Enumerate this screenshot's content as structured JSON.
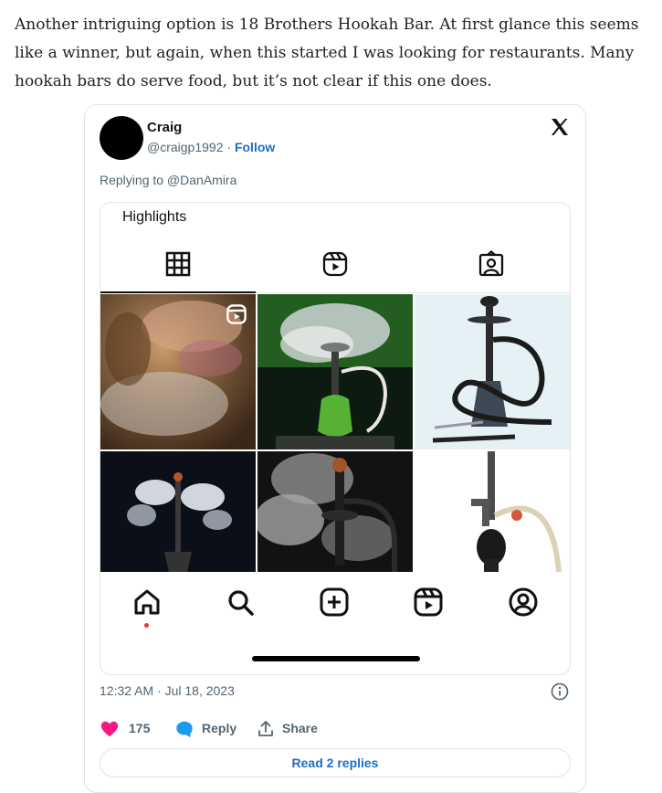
{
  "article": {
    "paragraph": "Another intriguing option is 18 Brothers Hookah Bar. At first glance this seems like a winner, but again, when this started I was looking for restaurants. Many hookah bars do serve food, but it’s not clear if this one does."
  },
  "tweet": {
    "name": "Craig",
    "handle": "@craigp1992",
    "separator": " · ",
    "follow_label": "Follow",
    "replying_to": "Replying to @DanAmira",
    "timestamp": "12:32 AM · Jul 18, 2023",
    "likes": "175",
    "reply_label": "Reply",
    "share_label": "Share",
    "read_replies_label": "Read 2 replies",
    "like_color": "#f91880",
    "accent_color": "#1d6fc2"
  },
  "embed": {
    "highlights_label": "Highlights",
    "tabs": [
      "grid-icon",
      "reels-icon",
      "tagged-icon"
    ],
    "tiles": [
      {
        "subject": "smoky party scene",
        "reel_badge": true
      },
      {
        "subject": "green glass hookah with smoke"
      },
      {
        "subject": "black hookah with long hose"
      },
      {
        "subject": "hookah with twin smoke plumes"
      },
      {
        "subject": "hookah in dense smoke"
      },
      {
        "subject": "rifle-shaped hookah"
      }
    ],
    "bottom_nav": [
      "home-icon",
      "search-icon",
      "create-icon",
      "reels-icon",
      "profile-icon"
    ]
  }
}
